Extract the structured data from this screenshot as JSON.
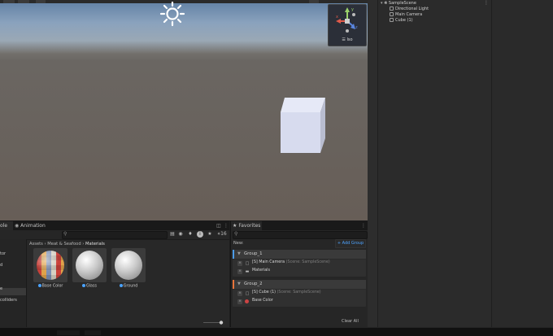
{
  "scene": {
    "gizmo_label": "☰ Iso"
  },
  "project": {
    "tabs": {
      "project": "ole",
      "animation": "Animation"
    },
    "layer_count": "16",
    "left_items": [
      "tor",
      "d",
      "",
      "e",
      "colliders"
    ],
    "breadcrumb": {
      "assets": "Assets",
      "folder": "Meat & Seafood",
      "current": "Materials"
    },
    "assets": [
      {
        "label": "Base Color"
      },
      {
        "label": "Glass"
      },
      {
        "label": "Ground"
      }
    ]
  },
  "favorites": {
    "tab_label": "Favorites",
    "new_label": "New:",
    "add_group_label": "+ Add Group",
    "groups": [
      {
        "title": "Group_1",
        "color": "#4c9be8",
        "items": [
          {
            "name": "[S] Main Camera",
            "meta": "(Scene: SampleScene)"
          },
          {
            "name": "Materials",
            "meta": ""
          }
        ]
      },
      {
        "title": "Group_2",
        "color": "#e8743b",
        "items": [
          {
            "name": "[S] Cube (1)",
            "meta": "(Scene: SampleScene)"
          },
          {
            "name": "Base Color",
            "meta": ""
          }
        ]
      }
    ],
    "clear_all_label": "Clear All"
  },
  "hierarchy": {
    "scene_name": "SampleScene",
    "items": [
      "Directional Light",
      "Main Camera",
      "Cube (1)"
    ]
  },
  "colors": {
    "accent": "#4ea4ff",
    "group1": "#4c9be8",
    "group2": "#e8743b"
  }
}
